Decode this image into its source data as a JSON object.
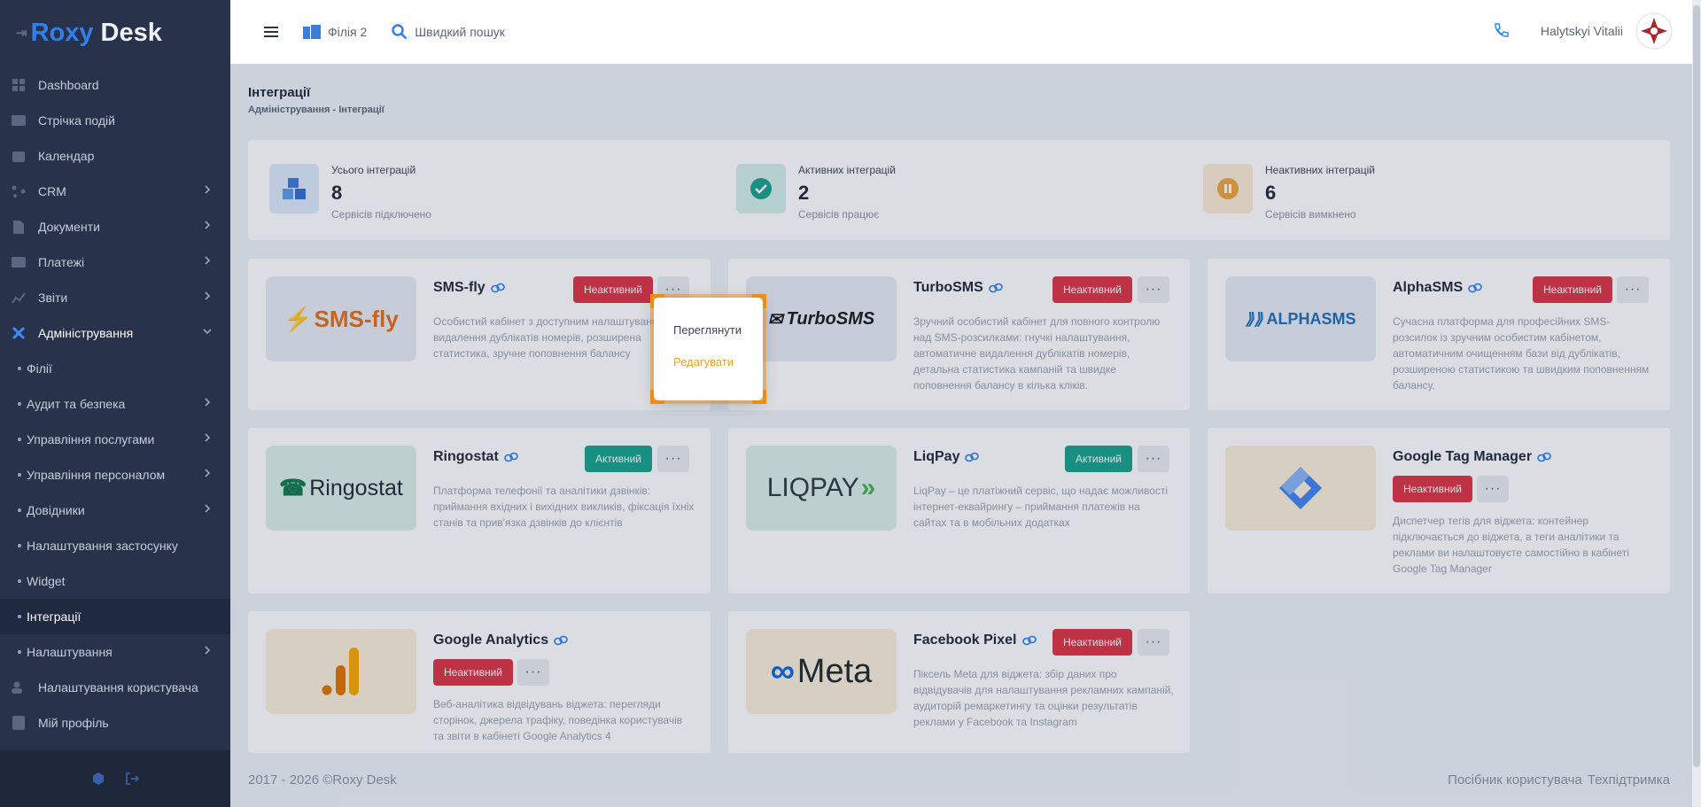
{
  "app": {
    "logo_part1": "Roxy",
    "logo_part2": "Desk"
  },
  "topbar": {
    "branch": "Філія 2",
    "search": "Швидкий пошук",
    "user": "Halytskyi Vitalii"
  },
  "sidebar": {
    "items": [
      {
        "label": "Dashboard"
      },
      {
        "label": "Стрічка подій"
      },
      {
        "label": "Календар"
      },
      {
        "label": "CRM"
      },
      {
        "label": "Документи"
      },
      {
        "label": "Платежі"
      },
      {
        "label": "Звіти"
      },
      {
        "label": "Адміністрування"
      },
      {
        "label": "Філії"
      },
      {
        "label": "Аудит та безпека"
      },
      {
        "label": "Управління послугами"
      },
      {
        "label": "Управління персоналом"
      },
      {
        "label": "Довідники"
      },
      {
        "label": "Налаштування застосунку"
      },
      {
        "label": "Widget"
      },
      {
        "label": "Інтеграції"
      },
      {
        "label": "Налаштування"
      },
      {
        "label": "Налаштування користувача"
      },
      {
        "label": "Мій профіль"
      }
    ]
  },
  "page": {
    "title": "Інтеграції",
    "breadcrumb": "Адміністрування - Інтеграції"
  },
  "stats": [
    {
      "title": "Усього інтеграцій",
      "value": "8",
      "sub": "Сервісів підключено"
    },
    {
      "title": "Активних інтеграцій",
      "value": "2",
      "sub": "Сервісів працює"
    },
    {
      "title": "Неактивних інтеграцій",
      "value": "6",
      "sub": "Сервісів вимкнено"
    }
  ],
  "status": {
    "inactive": "Неактивний",
    "active": "Активний"
  },
  "cards": [
    {
      "name": "SMS-fly",
      "logo": "SMS-fly",
      "status": "Неактивний",
      "desc": "Особистий кабінет з доступним налаштуванням видалення дублікатів номерів, розширена статистика, зручне поповнення балансу"
    },
    {
      "name": "TurboSMS",
      "logo": "TurboSMS",
      "status": "Неактивний",
      "desc": "Зручний особистий кабінет для повного контролю над SMS-розсилками: гнучкі налаштування, автоматичне видалення дублікатів номерів, детальна статистика кампаній та швидке поповнення балансу в кілька кліків."
    },
    {
      "name": "AlphaSMS",
      "logo": "ALPHASMS",
      "status": "Неактивний",
      "desc": "Сучасна платформа для професійних SMS-розсилок із зручним особистим кабінетом, автоматичним очищенням бази від дублікатів, розширеною статистикою та швидким поповненням балансу."
    },
    {
      "name": "Ringostat",
      "logo": "Ringostat",
      "status": "Активний",
      "desc": "Платформа телефонії та аналітики дзвінків: приймання вхідних і вихідних викликів, фіксація їхніх станів та прив'язка дзвінків до клієнтів"
    },
    {
      "name": "LiqPay",
      "logo": "LIQPAY",
      "status": "Активний",
      "desc": "LiqPay – це платіжний сервіс, що надає можливості інтернет-еквайрингу – приймання платежів на сайтах та в мобільних додатках"
    },
    {
      "name": "Google Tag Manager",
      "logo": "",
      "status": "Неактивний",
      "desc": "Диспетчер тегів для віджета: контейнер підключається до віджета, а теги аналітики та реклами ви налаштовуєте самостійно в кабінеті Google Tag Manager"
    },
    {
      "name": "Google Analytics",
      "logo": "",
      "status": "Неактивний",
      "desc": "Веб-аналітика відвідувань віджета: перегляди сторінок, джерела трафіку, поведінка користувачів та звіти в кабінеті Google Analytics 4"
    },
    {
      "name": "Facebook Pixel",
      "logo": "Meta",
      "status": "Неактивний",
      "desc": "Піксель Meta для віджета: збір даних про відвідувачів для налаштування рекламних кампаній, аудиторій ремаркетингу та оцінки результатів реклами у Facebook та Instagram"
    }
  ],
  "popup": {
    "view": "Переглянути",
    "edit": "Редагувати"
  },
  "footer": {
    "copyright": "2017 - 2026 ©Roxy Desk",
    "guide": "Посібник користувача",
    "support": "Техпідтримка"
  },
  "colors": {
    "sidebar": "#28324a",
    "accent": "#2f80ed",
    "inactive": "#dc3545",
    "active": "#17a38b",
    "highlight": "#f08c14"
  }
}
